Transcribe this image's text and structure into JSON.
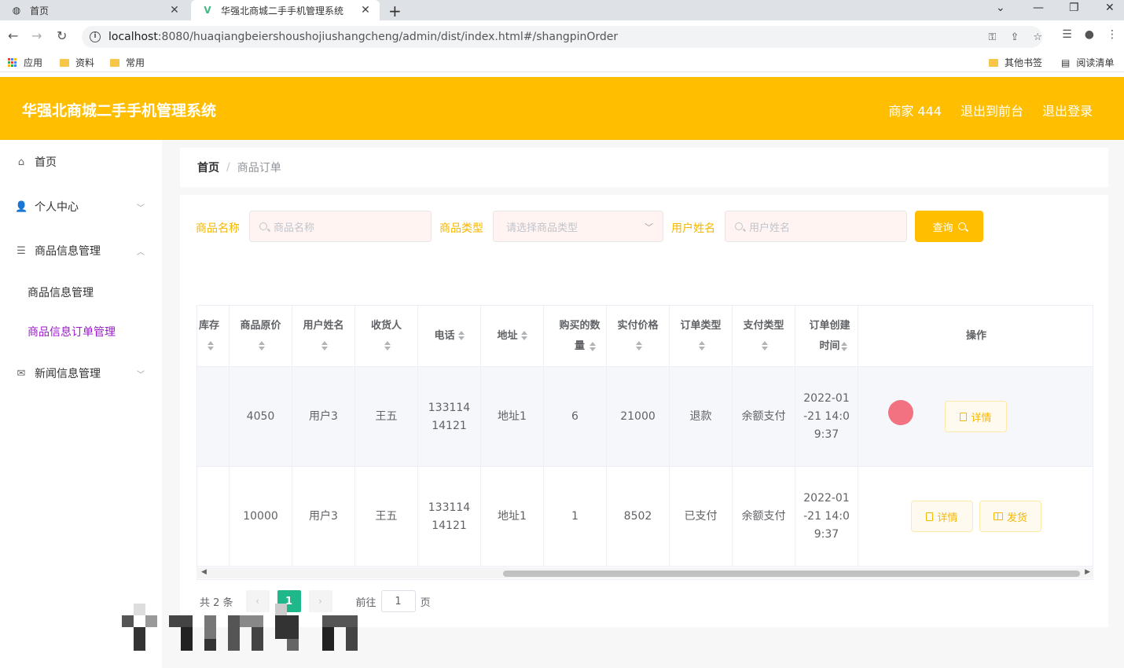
{
  "browser": {
    "tabs": [
      {
        "title": "首页",
        "active": false
      },
      {
        "title": "华强北商城二手手机管理系统",
        "active": true
      }
    ],
    "url_host": "localhost",
    "url_rest": ":8080/huaqiangbeiershoushojiushangcheng/admin/dist/index.html#/shangpinOrder",
    "bookmarks": [
      "应用",
      "资料",
      "常用"
    ],
    "bookmarks_right": [
      "其他书签",
      "阅读清单"
    ]
  },
  "header": {
    "title": "华强北商城二手手机管理系统",
    "user": "商家 444",
    "to_front": "退出到前台",
    "logout": "退出登录",
    "color": "#ffbf00"
  },
  "sidebar": {
    "items": [
      {
        "label": "首页",
        "icon": "home-icon"
      },
      {
        "label": "个人中心",
        "icon": "user-icon"
      },
      {
        "label": "商品信息管理",
        "icon": "list-icon"
      },
      {
        "label": "新闻信息管理",
        "icon": "mail-icon"
      }
    ],
    "submenu": [
      {
        "label": "商品信息管理",
        "active": false
      },
      {
        "label": "商品信息订单管理",
        "active": true
      }
    ]
  },
  "breadcrumb": {
    "home": "首页",
    "separator": "/",
    "current": "商品订单"
  },
  "search": {
    "name_label": "商品名称",
    "name_placeholder": "商品名称",
    "type_label": "商品类型",
    "type_placeholder": "请选择商品类型",
    "user_label": "用户姓名",
    "user_placeholder": "用户姓名",
    "query_label": "查询"
  },
  "table": {
    "columns": [
      "库存",
      "商品原价",
      "用户姓名",
      "收货人",
      "电话",
      "地址",
      "购买的数量",
      "实付价格",
      "订单类型",
      "支付类型",
      "订单创建时间",
      "操作"
    ],
    "rows": [
      {
        "stock": "",
        "price": "4050",
        "user": "用户3",
        "receiver": "王五",
        "phone": "13311414121",
        "address": "地址1",
        "qty": "6",
        "paid": "21000",
        "order_type": "退款",
        "pay_type": "余额支付",
        "created": "2022-01-21 14:09:37",
        "actions": [
          "详情"
        ]
      },
      {
        "stock": "",
        "price": "10000",
        "user": "用户3",
        "receiver": "王五",
        "phone": "13311414121",
        "address": "地址1",
        "qty": "1",
        "paid": "8502",
        "order_type": "已支付",
        "pay_type": "余额支付",
        "created": "2022-01-21 14:09:37",
        "actions": [
          "详情",
          "发货"
        ]
      }
    ]
  },
  "pagination": {
    "total": "共 2 条",
    "current": "1",
    "goto_prefix": "前往",
    "goto_value": "1",
    "goto_suffix": "页"
  }
}
